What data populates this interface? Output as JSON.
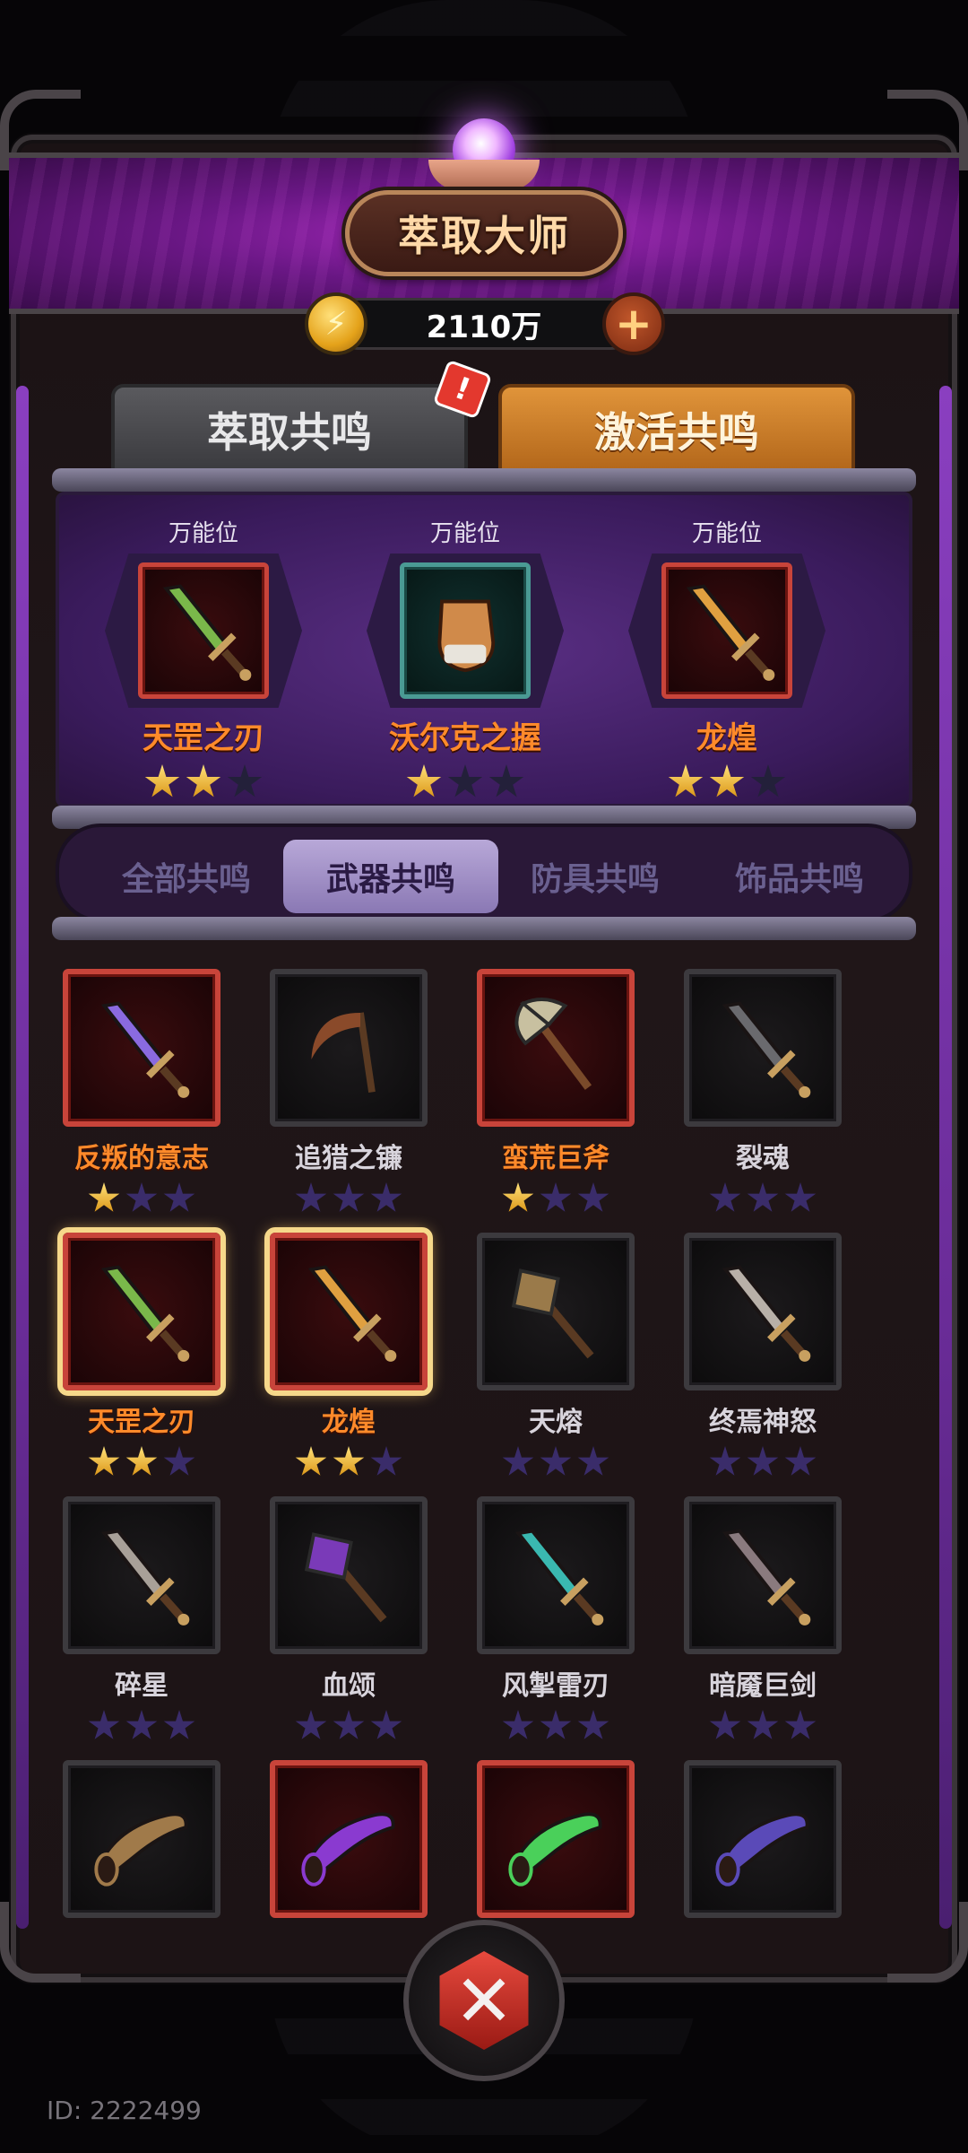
{
  "header": {
    "title": "萃取大师",
    "currency": "2110万",
    "plus_symbol": "+"
  },
  "tabs": {
    "extract": "萃取共鸣",
    "activate": "激活共鸣",
    "alert_badge": "!"
  },
  "slots": [
    {
      "caption": "万能位",
      "name": "天罡之刃",
      "stars": 2,
      "frame": "red",
      "icon": "sword-green-icon"
    },
    {
      "caption": "万能位",
      "name": "沃尔克之握",
      "stars": 1,
      "frame": "teal",
      "icon": "gauntlet-icon"
    },
    {
      "caption": "万能位",
      "name": "龙煌",
      "stars": 2,
      "frame": "red",
      "icon": "sword-gold-icon"
    }
  ],
  "categories": {
    "all": "全部共鸣",
    "weapon": "武器共鸣",
    "armor": "防具共鸣",
    "accessory": "饰品共鸣",
    "active": "weapon"
  },
  "items": [
    {
      "name": "反叛的意志",
      "stars": 1,
      "frame": "red",
      "name_color": "orange",
      "icon": "crystal-sword-icon",
      "color": "#8a6ae0"
    },
    {
      "name": "追猎之镰",
      "stars": 0,
      "frame": "gray",
      "name_color": "gray",
      "icon": "scythe-icon",
      "color": "#8a4a2a"
    },
    {
      "name": "蛮荒巨斧",
      "stars": 1,
      "frame": "red",
      "name_color": "orange",
      "icon": "axe-icon",
      "color": "#c8c0a0"
    },
    {
      "name": "裂魂",
      "stars": 0,
      "frame": "gray",
      "name_color": "gray",
      "icon": "dark-sword-icon",
      "color": "#6a6a6e"
    },
    {
      "name": "天罡之刃",
      "stars": 2,
      "frame": "red",
      "name_color": "orange",
      "icon": "sword-green-icon",
      "color": "#7ab84a",
      "selected": true
    },
    {
      "name": "龙煌",
      "stars": 2,
      "frame": "red",
      "name_color": "orange",
      "icon": "sword-gold-icon",
      "color": "#e0a040",
      "selected": true
    },
    {
      "name": "天熔",
      "stars": 0,
      "frame": "gray",
      "name_color": "gray",
      "icon": "mace-icon",
      "color": "#9a7a4a"
    },
    {
      "name": "终焉神怒",
      "stars": 0,
      "frame": "gray",
      "name_color": "gray",
      "icon": "feather-sword-icon",
      "color": "#b8b0a8"
    },
    {
      "name": "碎星",
      "stars": 0,
      "frame": "gray",
      "name_color": "gray",
      "icon": "dagger-icon",
      "color": "#a8a098"
    },
    {
      "name": "血颂",
      "stars": 0,
      "frame": "gray",
      "name_color": "gray",
      "icon": "purple-mace-icon",
      "color": "#7a3ab8"
    },
    {
      "name": "风掣雷刃",
      "stars": 0,
      "frame": "gray",
      "name_color": "gray",
      "icon": "teal-sword-icon",
      "color": "#3ab8b0"
    },
    {
      "name": "暗魇巨剑",
      "stars": 0,
      "frame": "gray",
      "name_color": "gray",
      "icon": "jagged-sword-icon",
      "color": "#8a7a7e"
    },
    {
      "name": "",
      "stars": 0,
      "frame": "gray",
      "name_color": "gray",
      "icon": "horn-icon",
      "color": "#a07a4a"
    },
    {
      "name": "",
      "stars": 0,
      "frame": "red",
      "name_color": "orange",
      "icon": "purple-horn-icon",
      "color": "#8a3ad0"
    },
    {
      "name": "",
      "stars": 0,
      "frame": "red",
      "name_color": "orange",
      "icon": "green-horn-icon",
      "color": "#4ad05a"
    },
    {
      "name": "",
      "stars": 0,
      "frame": "gray",
      "name_color": "gray",
      "icon": "blue-horn-icon",
      "color": "#5a4ab8"
    }
  ],
  "footer": {
    "id": "ID: 2222499",
    "emblem_glyph": "✕"
  }
}
